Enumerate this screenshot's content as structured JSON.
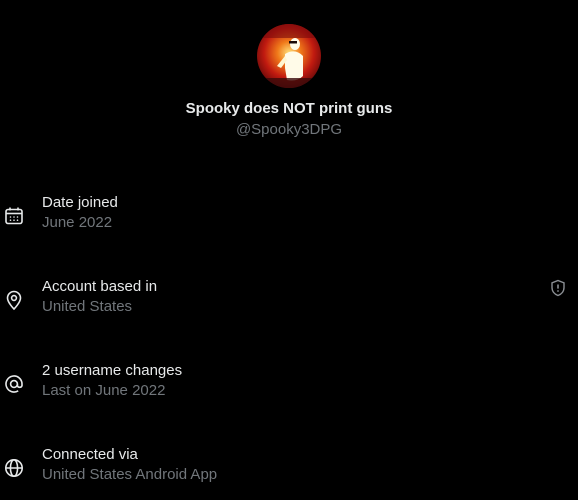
{
  "profile": {
    "display_name": "Spooky does NOT print guns",
    "handle": "@Spooky3DPG"
  },
  "details": [
    {
      "icon": "calendar-icon",
      "label": "Date joined",
      "value": "June 2022"
    },
    {
      "icon": "location-pin-icon",
      "label": "Account based in",
      "value": "United States",
      "badge_icon": "shield-icon"
    },
    {
      "icon": "at-sign-icon",
      "label": "2 username changes",
      "value": "Last on June 2022"
    },
    {
      "icon": "globe-icon",
      "label": "Connected via",
      "value": "United States Android App"
    }
  ],
  "colors": {
    "background": "#000000",
    "primary_text": "#e7e9ea",
    "secondary_text": "#71767b"
  }
}
